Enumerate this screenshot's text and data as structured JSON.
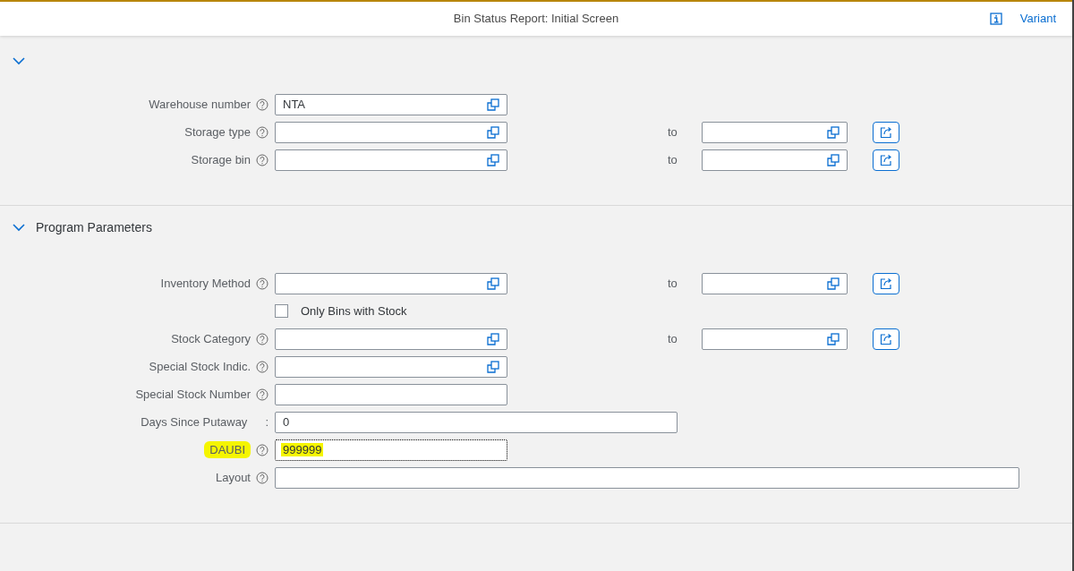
{
  "header": {
    "title": "Bin Status Report: Initial Screen",
    "variant_link": "Variant"
  },
  "sections": [
    {
      "expanded": true,
      "rows": [
        {
          "kind": "single_help",
          "label": "Warehouse number",
          "help": true,
          "value": "NTA",
          "highlighted": false
        },
        {
          "kind": "range",
          "label": "Storage type",
          "help": true,
          "value": "",
          "to_label": "to",
          "to_value": "",
          "highlighted": false
        },
        {
          "kind": "range",
          "label": "Storage bin",
          "help": true,
          "value": "",
          "to_label": "to",
          "to_value": "",
          "highlighted": false
        }
      ]
    },
    {
      "title": "Program Parameters",
      "expanded": true,
      "rows": [
        {
          "kind": "range",
          "label": "Inventory Method",
          "help": true,
          "value": "",
          "to_label": "to",
          "to_value": "",
          "highlighted": false
        },
        {
          "kind": "checkbox",
          "label": "Only Bins with Stock",
          "checked": false
        },
        {
          "kind": "range",
          "label": "Stock Category",
          "help": true,
          "value": "",
          "to_label": "to",
          "to_value": "",
          "highlighted": false
        },
        {
          "kind": "single_help",
          "label": "Special Stock Indic.",
          "help": true,
          "value": "",
          "highlighted": false
        },
        {
          "kind": "plain",
          "label": "Special Stock Number",
          "help": true,
          "value": "",
          "highlighted": false
        },
        {
          "kind": "wide",
          "label": "Days Since Putaway",
          "help": false,
          "separator": ":",
          "value": "0",
          "highlighted": false
        },
        {
          "kind": "plain",
          "label": "DAUBI",
          "help": true,
          "value": "999999",
          "highlighted": true
        },
        {
          "kind": "full",
          "label": "Layout",
          "help": true,
          "value": "",
          "highlighted": false
        }
      ]
    }
  ]
}
